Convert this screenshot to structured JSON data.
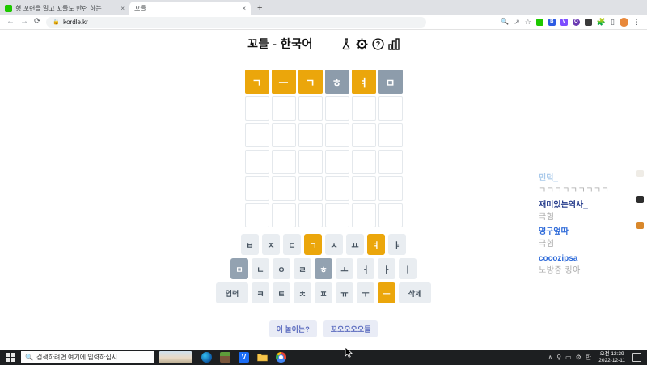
{
  "browser": {
    "tabs": [
      {
        "title": "형 꼬련을 밀고 꼬들도 만련 하는",
        "close": "×"
      },
      {
        "title": "꼬들",
        "close": "×"
      }
    ],
    "new_tab_label": "+",
    "nav": {
      "back": "←",
      "forward": "→",
      "reload": "⟳"
    },
    "url": "kordle.kr",
    "toolbar": {
      "zoom": "🔍",
      "share": "↗",
      "bookmark": "☆",
      "ext_b": "B",
      "ext_v": "V",
      "ext_o": "O",
      "menu": "⋮"
    }
  },
  "game": {
    "title": "꼬들 - 한국어",
    "header_icons": [
      "flask-icon",
      "gear-icon",
      "help-icon",
      "stats-icon"
    ],
    "grid": {
      "rows": 6,
      "cols": 6,
      "guess_row": [
        {
          "letter": "ㄱ",
          "state": "yellow"
        },
        {
          "letter": "ㅡ",
          "state": "yellow"
        },
        {
          "letter": "ㄱ",
          "state": "yellow"
        },
        {
          "letter": "ㅎ",
          "state": "gray"
        },
        {
          "letter": "ㅕ",
          "state": "yellow"
        },
        {
          "letter": "ㅁ",
          "state": "gray"
        }
      ],
      "empty_rows": 5
    },
    "keyboard": [
      [
        {
          "key": "ㅂ",
          "state": "default"
        },
        {
          "key": "ㅈ",
          "state": "default"
        },
        {
          "key": "ㄷ",
          "state": "default"
        },
        {
          "key": "ㄱ",
          "state": "yellow"
        },
        {
          "key": "ㅅ",
          "state": "default"
        },
        {
          "key": "ㅛ",
          "state": "default"
        },
        {
          "key": "ㅕ",
          "state": "yellow"
        },
        {
          "key": "ㅑ",
          "state": "default"
        }
      ],
      [
        {
          "key": "ㅁ",
          "state": "gray"
        },
        {
          "key": "ㄴ",
          "state": "default"
        },
        {
          "key": "ㅇ",
          "state": "default"
        },
        {
          "key": "ㄹ",
          "state": "default"
        },
        {
          "key": "ㅎ",
          "state": "gray"
        },
        {
          "key": "ㅗ",
          "state": "default"
        },
        {
          "key": "ㅓ",
          "state": "default"
        },
        {
          "key": "ㅏ",
          "state": "default"
        },
        {
          "key": "ㅣ",
          "state": "default"
        }
      ],
      [
        {
          "key": "입력",
          "state": "default",
          "wide": true
        },
        {
          "key": "ㅋ",
          "state": "default"
        },
        {
          "key": "ㅌ",
          "state": "default"
        },
        {
          "key": "ㅊ",
          "state": "default"
        },
        {
          "key": "ㅍ",
          "state": "default"
        },
        {
          "key": "ㅠ",
          "state": "default"
        },
        {
          "key": "ㅜ",
          "state": "default"
        },
        {
          "key": "ㅡ",
          "state": "yellow"
        },
        {
          "key": "삭제",
          "state": "default",
          "wide": true
        }
      ]
    ],
    "buttons": [
      {
        "label": "이 놀이는?"
      },
      {
        "label": "꼬오오오오들"
      }
    ]
  },
  "chat": {
    "messages": [
      {
        "user": "민덕_",
        "color": "#a9c9ea",
        "text": "ㄱㄱㄱㄱㄱㄱㄱㄱㄱ"
      },
      {
        "user": "재미있는역사_",
        "color": "#22398a",
        "text": "극혐"
      },
      {
        "user": "영구엎따",
        "color": "#2f6bd9",
        "text": "극혐"
      },
      {
        "user": "cocozipsa",
        "color": "#2f6bd9",
        "text": "노방중 킹아"
      }
    ],
    "avatar_colors": [
      "#efece6",
      "#2d2d2d",
      "#d9882b"
    ]
  },
  "taskbar": {
    "search_placeholder": "검색하려면 여기에 입력하십시",
    "time": "오전 12:39",
    "date": "2022-12-11"
  },
  "colors": {
    "tile_yellow": "#eba60b",
    "tile_gray": "#8d9cab",
    "key_default": "#e9edf1"
  }
}
